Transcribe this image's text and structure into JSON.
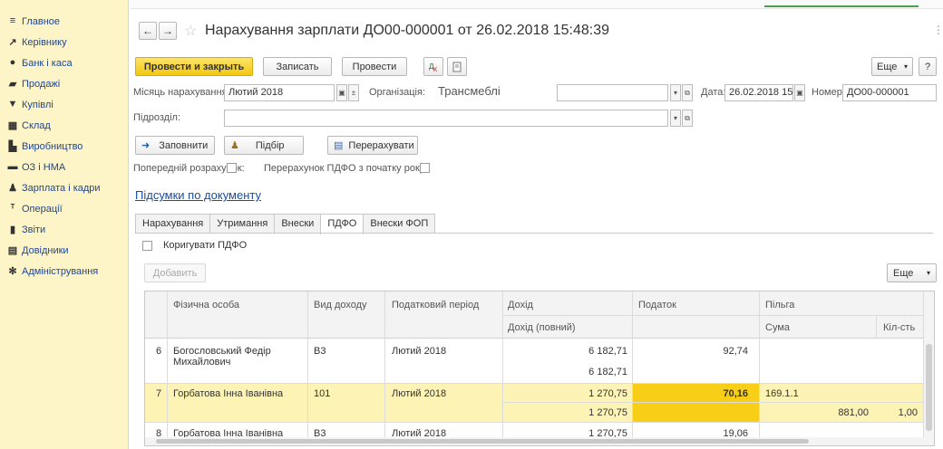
{
  "sidebar": {
    "items": [
      {
        "label": "Главное",
        "icon": "≡"
      },
      {
        "label": "Керівнику",
        "icon": "↗"
      },
      {
        "label": "Банк і каса",
        "icon": "●"
      },
      {
        "label": "Продажі",
        "icon": "▰"
      },
      {
        "label": "Купівлі",
        "icon": "▼"
      },
      {
        "label": "Склад",
        "icon": "▦"
      },
      {
        "label": "Виробництво",
        "icon": "▙"
      },
      {
        "label": "ОЗ і НМА",
        "icon": "▬"
      },
      {
        "label": "Зарплата і кадри",
        "icon": "♟"
      },
      {
        "label": "Операції",
        "icon": "ᵀ"
      },
      {
        "label": "Звіти",
        "icon": "▮"
      },
      {
        "label": "Довідники",
        "icon": "▤"
      },
      {
        "label": "Адміністрування",
        "icon": "✻"
      }
    ]
  },
  "header": {
    "back": "←",
    "forward": "→",
    "star": "☆",
    "title": "Нарахування зарплати ДО00-000001 от 26.02.2018 15:48:39",
    "close": "⋮"
  },
  "toolbar": {
    "post_close": "Провести и закрыть",
    "save": "Записать",
    "post": "Провести",
    "more": "Еще",
    "more_arrow": "▾",
    "help": "?"
  },
  "form": {
    "month_label": "Місяць нарахування:",
    "month_value": "Лютий 2018",
    "org_label": "Організація:",
    "org_value": "Трансмеблі",
    "date_label": "Дата:",
    "date_value": "26.02.2018 15",
    "number_label": "Номер:",
    "number_value": "ДО00-000001",
    "dept_label": "Підрозділ:",
    "dept_value": "",
    "fill": "Заповнити",
    "pick": "Підбір",
    "recalc": "Перерахувати",
    "prelim_label": "Попередній розрахунок:",
    "recalc_pdfo_label": "Перерахунок ПДФО з початку року:",
    "totals_link": "Підсумки по документу"
  },
  "tabs": [
    "Нарахування",
    "Утримання",
    "Внески",
    "ПДФО",
    "Внески ФОП"
  ],
  "pdfo": {
    "correct_label": "Коригувати ПДФО",
    "add": "Добавить",
    "more": "Еще",
    "more_arrow": "▾"
  },
  "table": {
    "headers": {
      "person": "Фізична особа",
      "income_type": "Вид доходу",
      "tax_period": "Податковий період",
      "income": "Дохід",
      "income_full": "Дохід (повний)",
      "tax": "Податок",
      "benefit": "Пільга",
      "sum": "Сума",
      "qty": "Кіл-сть"
    },
    "rows": [
      {
        "n": "6",
        "person1": "Богословський Федір",
        "person2": "Михайлович",
        "type": "В3",
        "period": "Лютий 2018",
        "income": "6 182,71",
        "income_full": "6 182,71",
        "tax": "92,74",
        "benefit": "",
        "sum": "",
        "qty": ""
      },
      {
        "n": "7",
        "person1": "Горбатова Інна Іванівна",
        "person2": "",
        "type": "101",
        "period": "Лютий 2018",
        "income": "1 270,75",
        "income_full": "1 270,75",
        "tax": "70,16",
        "benefit": "169.1.1",
        "sum": "881,00",
        "qty": "1,00"
      },
      {
        "n": "8",
        "person1": "Горбатова Інна Іванівна",
        "person2": "",
        "type": "В3",
        "period": "Лютий 2018",
        "income": "1 270,75",
        "income_full": "",
        "tax": "19,06",
        "benefit": "",
        "sum": "",
        "qty": ""
      }
    ]
  }
}
